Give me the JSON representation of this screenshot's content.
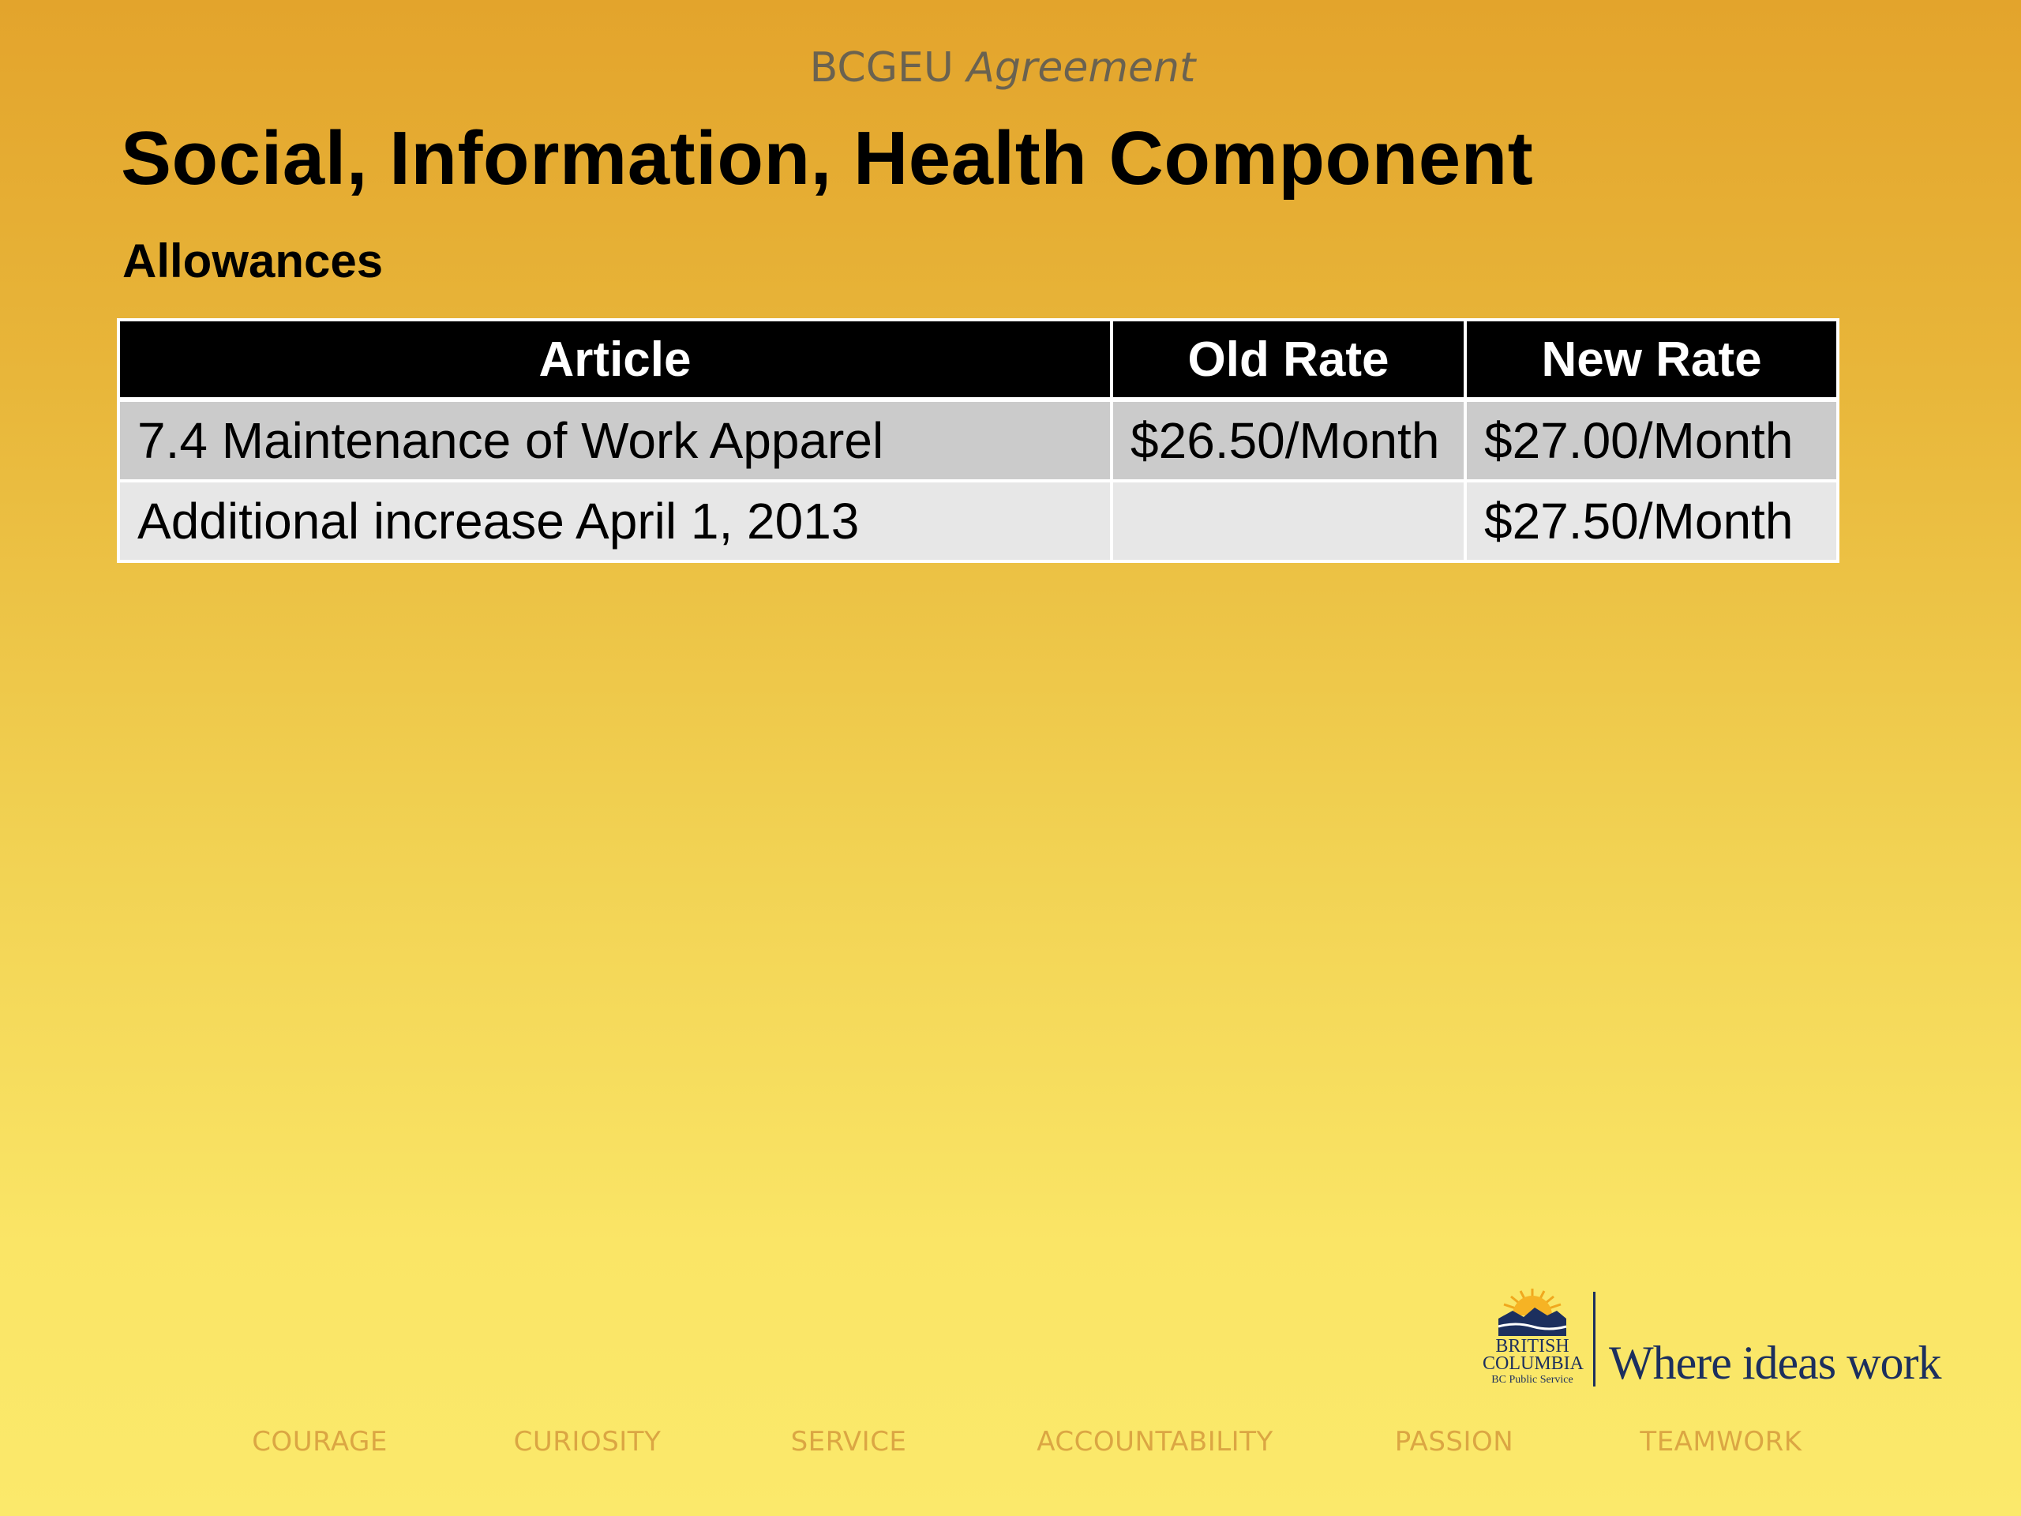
{
  "header": {
    "subtitle_org": "BCGEU",
    "subtitle_doc": "Agreement",
    "title": "Social, Information, Health Component",
    "section": "Allowances"
  },
  "table": {
    "headers": [
      "Article",
      "Old Rate",
      "New Rate"
    ],
    "rows": [
      [
        "7.4 Maintenance of Work Apparel",
        "$26.50/Month",
        "$27.00/Month"
      ],
      [
        "Additional increase April 1, 2013",
        "",
        "$27.50/Month"
      ]
    ],
    "header_bg": "#000000",
    "row_colors": [
      "#cbcbcb",
      "#e7e7e7"
    ]
  },
  "logo": {
    "line1": "BRITISH",
    "line2": "COLUMBIA",
    "line3": "BC Public Service",
    "tagline": "Where ideas work",
    "icon": "bc-sun-mountain-icon"
  },
  "values": [
    "COURAGE",
    "CURIOSITY",
    "SERVICE",
    "ACCOUNTABILITY",
    "PASSION",
    "TEAMWORK"
  ],
  "colors": {
    "background_top": "#e3a42c",
    "background_bottom": "#fbe96b",
    "values_text": "#dba643",
    "brand_navy": "#1c2f5e"
  }
}
